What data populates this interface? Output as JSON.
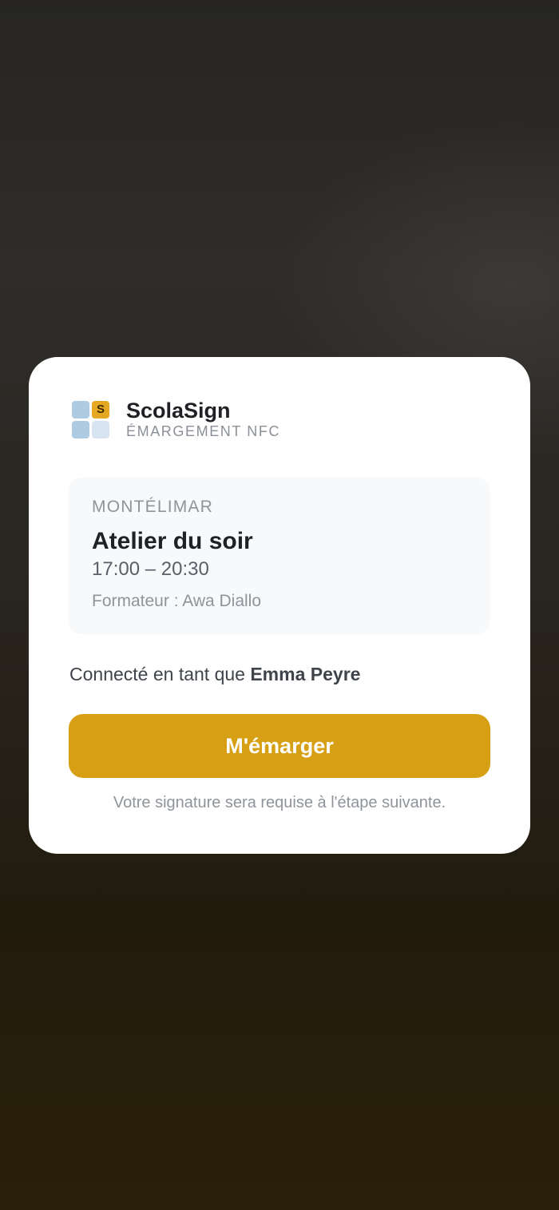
{
  "brand": {
    "logo_letter": "S",
    "name": "ScolaSign",
    "subtitle": "ÉMARGEMENT NFC",
    "colors": {
      "tile_blue": "#aecbe2",
      "tile_gold": "#e4a823",
      "tile_light": "#d7e3ee"
    }
  },
  "session": {
    "city": "MONTÉLIMAR",
    "title": "Atelier du soir",
    "time": "17:00 – 20:30",
    "trainer": "Formateur : Awa Diallo"
  },
  "user": {
    "prefix": "Connecté en tant que ",
    "name": "Emma Peyre"
  },
  "action": {
    "label": "M'émarger",
    "color": "#d7a014"
  },
  "note": "Votre signature sera requise à l'étape suivante."
}
